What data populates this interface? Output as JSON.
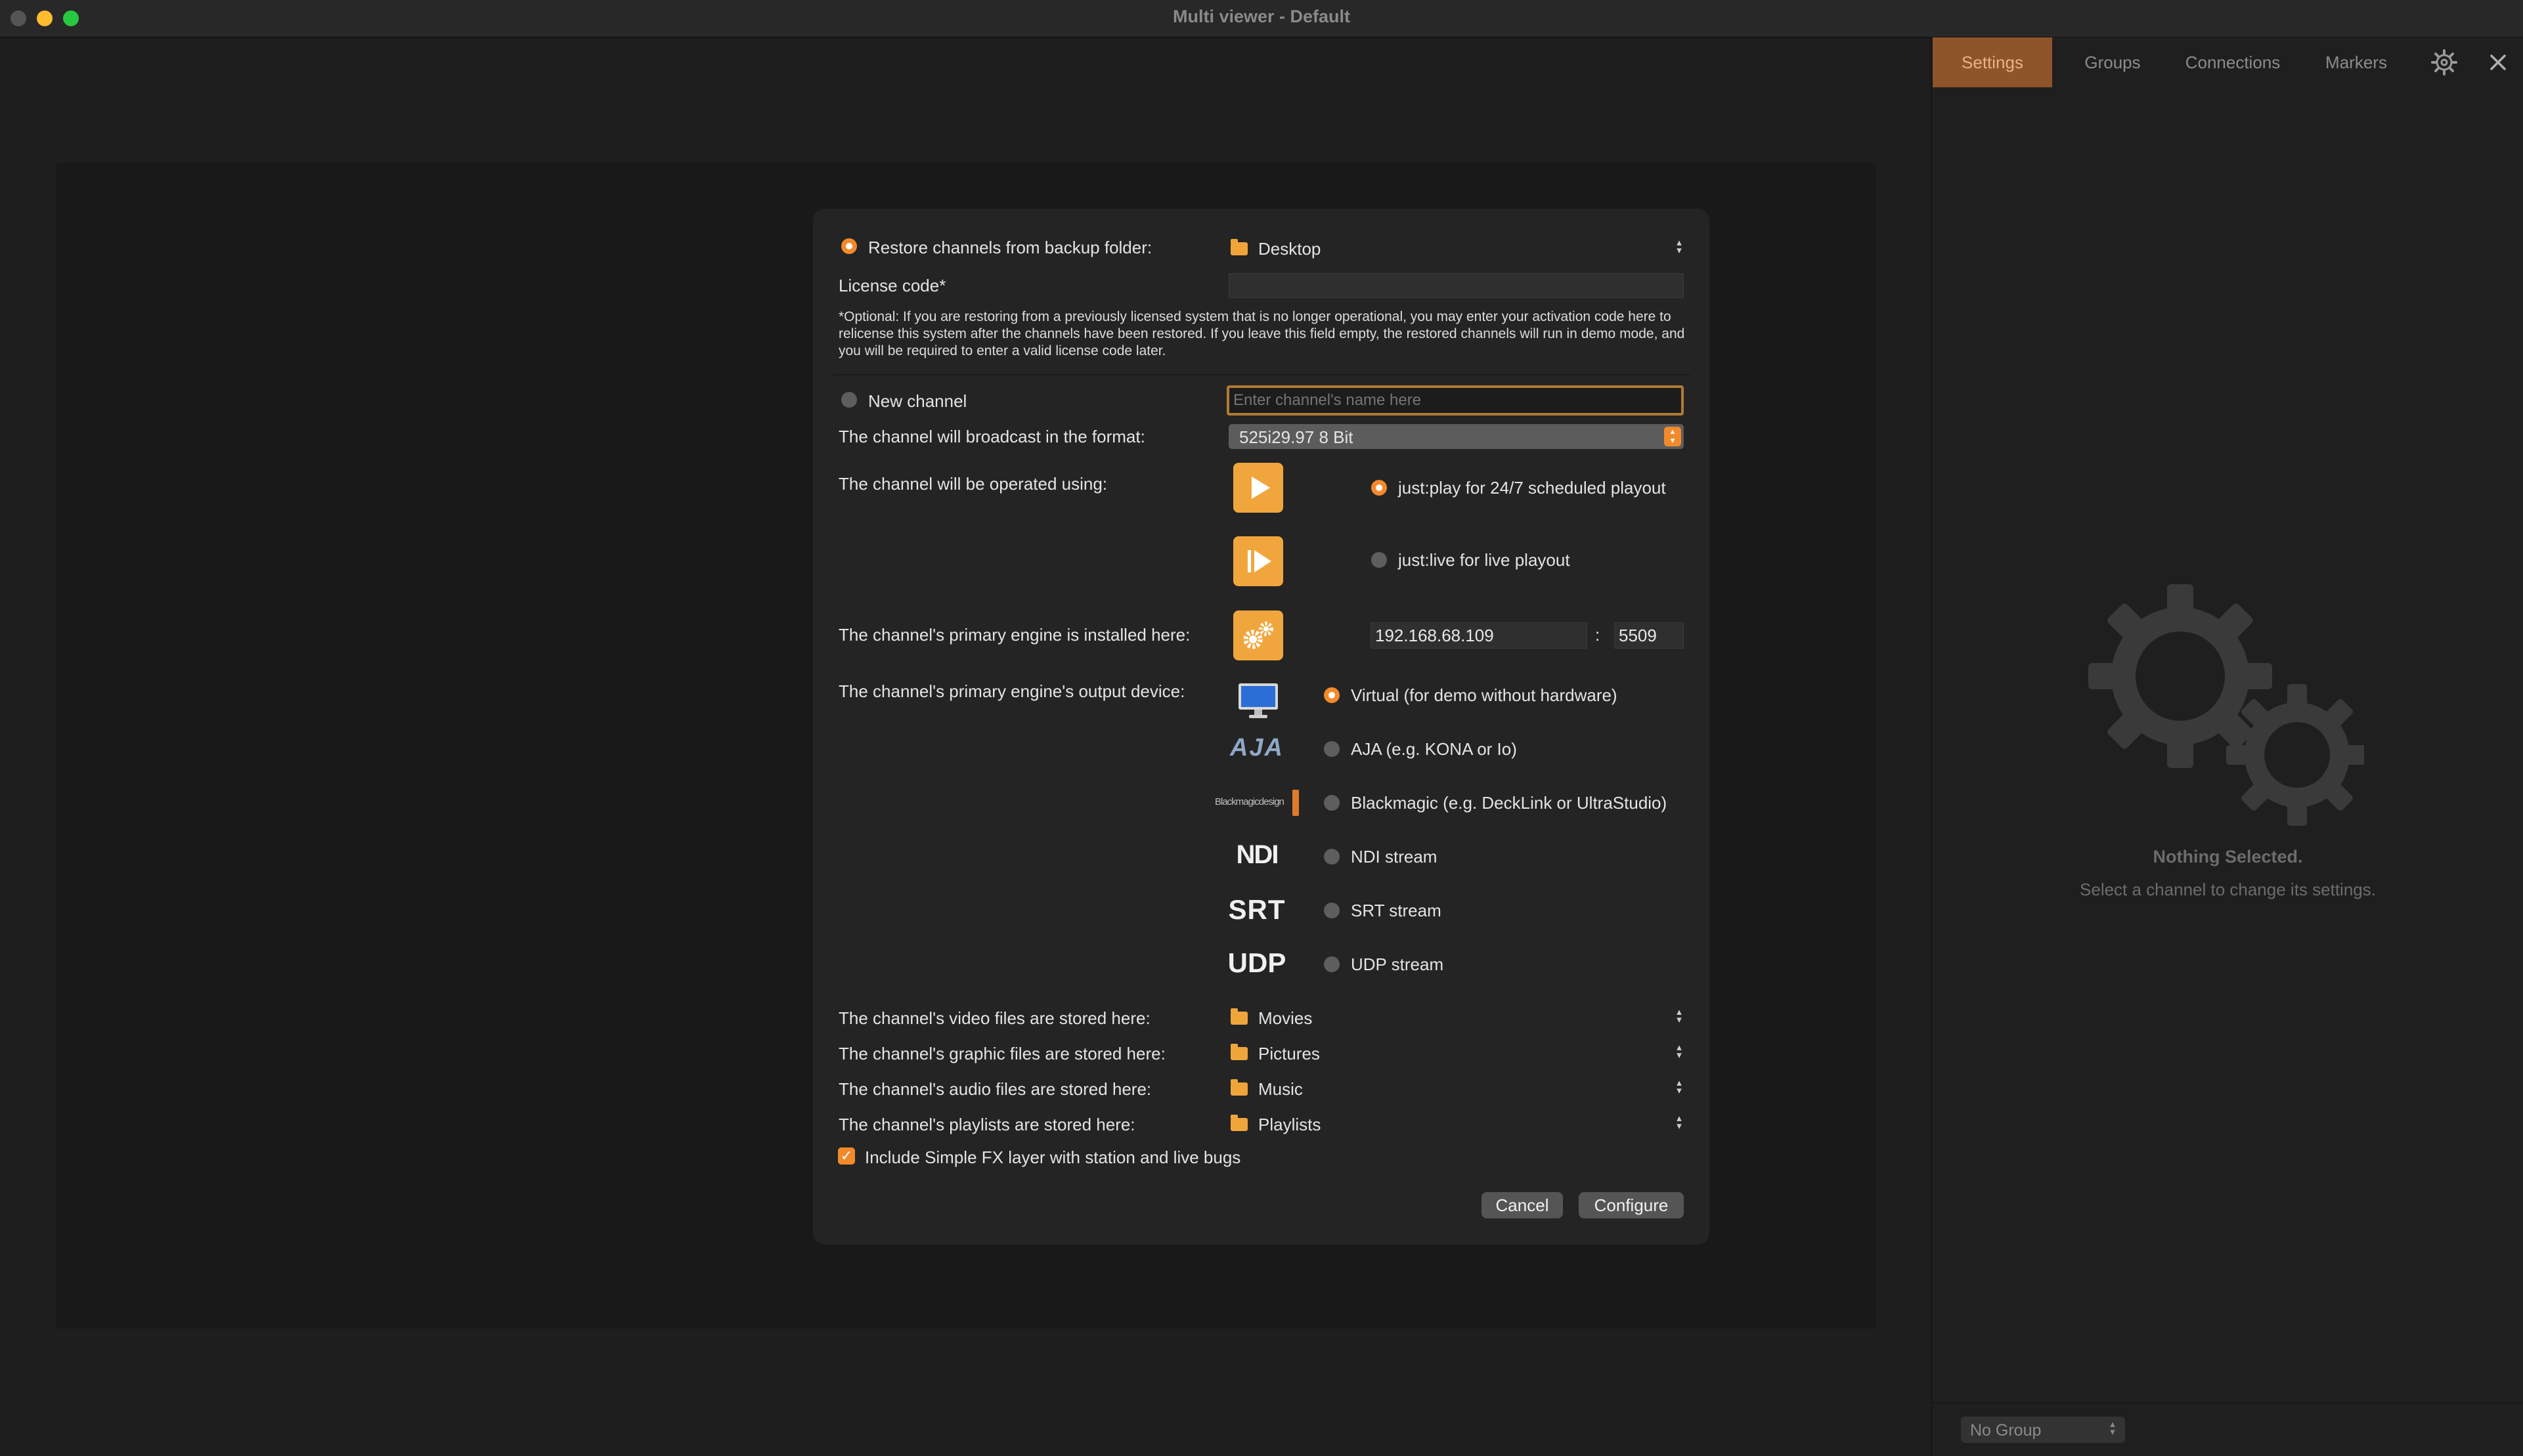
{
  "window": {
    "title": "Multi viewer - Default"
  },
  "tabs": [
    {
      "label": "Settings",
      "active": true
    },
    {
      "label": "Groups"
    },
    {
      "label": "Connections"
    },
    {
      "label": "Markers"
    }
  ],
  "panel": {
    "nothing_selected": "Nothing Selected.",
    "hint": "Select a channel to change its settings.",
    "group_select": "No Group"
  },
  "dialog": {
    "restore": {
      "label": "Restore channels from backup folder:",
      "folder": "Desktop",
      "selected": true
    },
    "license": {
      "label": "License code*",
      "value": "",
      "note": "*Optional: If you are restoring from a previously licensed system that is no longer operational, you may enter your activation code here to relicense this system after the channels have been restored. If you leave this field empty, the restored channels will run in demo mode, and you will be required to enter a valid license code later."
    },
    "new_channel": {
      "label": "New channel",
      "placeholder": "Enter channel's name here",
      "selected": false
    },
    "format": {
      "label": "The channel will broadcast in the format:",
      "value": "525i29.97 8 Bit"
    },
    "operated": {
      "label": "The channel will be operated using:",
      "options": [
        {
          "label": "just:play for 24/7 scheduled playout",
          "selected": true
        },
        {
          "label": "just:live for live playout",
          "selected": false
        }
      ]
    },
    "engine": {
      "label": "The channel's primary engine is installed here:",
      "ip": "192.168.68.109",
      "separator": ":",
      "port": "5509"
    },
    "output": {
      "label": "The channel's primary engine's output device:",
      "options": [
        {
          "label": "Virtual (for demo without hardware)",
          "logo": "monitor-icon",
          "selected": true
        },
        {
          "label": "AJA (e.g. KONA or Io)",
          "logo": "AJA",
          "selected": false
        },
        {
          "label": "Blackmagic (e.g. DeckLink or UltraStudio)",
          "logo": "Blackmagicdesign",
          "selected": false
        },
        {
          "label": "NDI stream",
          "logo": "NDI",
          "selected": false
        },
        {
          "label": "SRT stream",
          "logo": "SRT",
          "selected": false
        },
        {
          "label": "UDP stream",
          "logo": "UDP",
          "selected": false
        }
      ]
    },
    "storage": [
      {
        "label": "The channel's video files are stored here:",
        "folder": "Movies"
      },
      {
        "label": "The channel's graphic files are stored here:",
        "folder": "Pictures"
      },
      {
        "label": "The channel's audio files are stored here:",
        "folder": "Music"
      },
      {
        "label": "The channel's playlists are stored here:",
        "folder": "Playlists"
      }
    ],
    "simple_fx": {
      "label": "Include Simple FX layer with station and live bugs",
      "checked": true
    },
    "cancel": "Cancel",
    "configure": "Configure"
  },
  "colors": {
    "accent": "#f28a2c",
    "active_tab_bg": "#8e542a",
    "icon_orange": "#f1a63d"
  }
}
